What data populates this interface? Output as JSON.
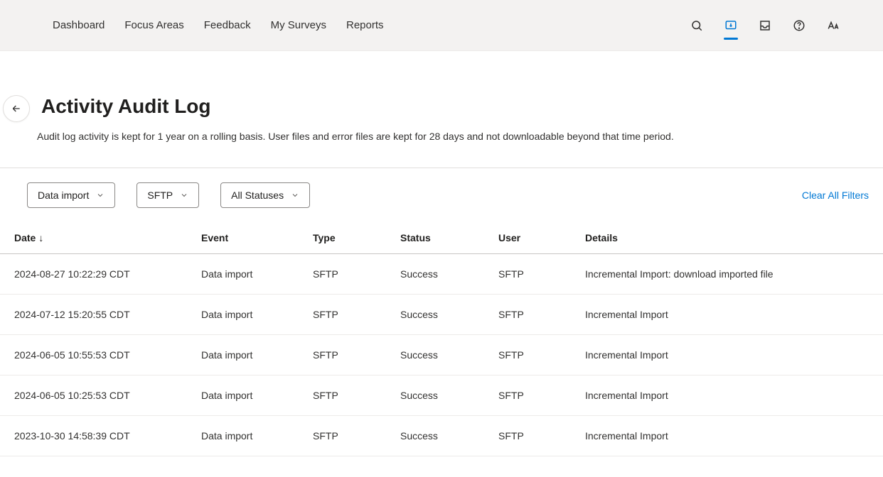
{
  "nav": {
    "items": [
      {
        "label": "Dashboard"
      },
      {
        "label": "Focus Areas"
      },
      {
        "label": "Feedback"
      },
      {
        "label": "My Surveys"
      },
      {
        "label": "Reports"
      }
    ]
  },
  "header": {
    "title": "Activity Audit Log",
    "subtitle": "Audit log activity is kept for 1 year on a rolling basis. User files and error files are kept for 28 days and not downloadable beyond that time period."
  },
  "filters": {
    "items": [
      {
        "label": "Data import"
      },
      {
        "label": "SFTP"
      },
      {
        "label": "All Statuses"
      }
    ],
    "clear_label": "Clear All Filters"
  },
  "table": {
    "columns": {
      "date": "Date",
      "event": "Event",
      "type": "Type",
      "status": "Status",
      "user": "User",
      "details": "Details"
    },
    "sort_indicator": "↓",
    "rows": [
      {
        "date": "2024-08-27 10:22:29 CDT",
        "event": "Data import",
        "type": "SFTP",
        "status": "Success",
        "user": "SFTP",
        "details_prefix": "Incremental Import: ",
        "details_link": "download imported file"
      },
      {
        "date": "2024-07-12 15:20:55 CDT",
        "event": "Data import",
        "type": "SFTP",
        "status": "Success",
        "user": "SFTP",
        "details_prefix": "Incremental Import",
        "details_link": ""
      },
      {
        "date": "2024-06-05 10:55:53 CDT",
        "event": "Data import",
        "type": "SFTP",
        "status": "Success",
        "user": "SFTP",
        "details_prefix": "Incremental Import",
        "details_link": ""
      },
      {
        "date": "2024-06-05 10:25:53 CDT",
        "event": "Data import",
        "type": "SFTP",
        "status": "Success",
        "user": "SFTP",
        "details_prefix": "Incremental Import",
        "details_link": ""
      },
      {
        "date": "2023-10-30 14:58:39 CDT",
        "event": "Data import",
        "type": "SFTP",
        "status": "Success",
        "user": "SFTP",
        "details_prefix": "Incremental Import",
        "details_link": ""
      }
    ]
  }
}
